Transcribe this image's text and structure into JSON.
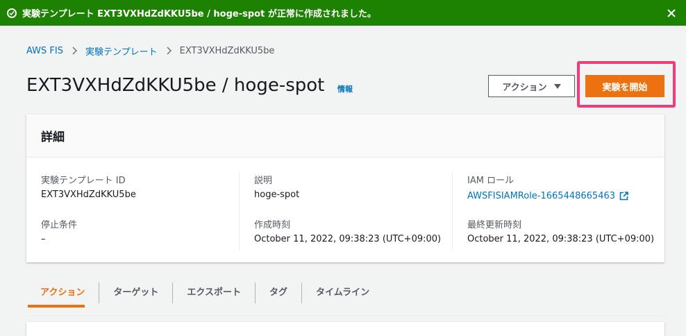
{
  "flash": {
    "message": "実験テンプレート EXT3VXHdZdKKU5be / hoge-spot が正常に作成されました。"
  },
  "breadcrumb": {
    "items": [
      "AWS FIS",
      "実験テンプレート"
    ],
    "current": "EXT3VXHdZdKKU5be"
  },
  "header": {
    "title": "EXT3VXHdZdKKU5be / hoge-spot",
    "info": "情報",
    "actions_label": "アクション",
    "start_label": "実験を開始"
  },
  "details": {
    "title": "詳細",
    "fields": [
      {
        "label": "実験テンプレート ID",
        "value": "EXT3VXHdZdKKU5be"
      },
      {
        "label": "停止条件",
        "value": "–"
      },
      {
        "label": "説明",
        "value": "hoge-spot"
      },
      {
        "label": "作成時刻",
        "value": "October 11, 2022, 09:38:23 (UTC+09:00)"
      },
      {
        "label": "IAM ロール",
        "value": "AWSFISIAMRole-1665448665463"
      },
      {
        "label": "最終更新時刻",
        "value": "October 11, 2022, 09:38:23 (UTC+09:00)"
      }
    ]
  },
  "tabs": [
    "アクション",
    "ターゲット",
    "エクスポート",
    "タグ",
    "タイムライン"
  ],
  "colors": {
    "success": "#1d8102",
    "primary": "#ec7211",
    "link": "#0073bb",
    "highlight": "#ef3d7a"
  }
}
